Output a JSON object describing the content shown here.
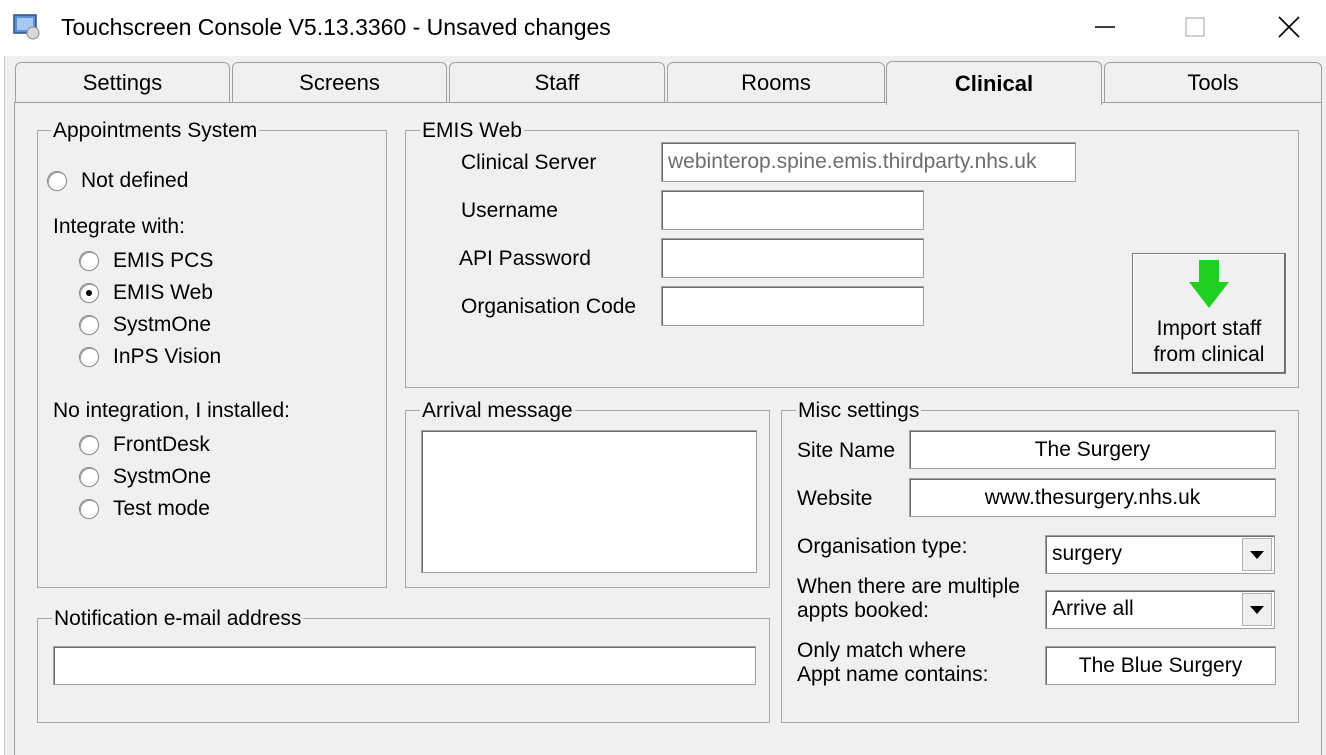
{
  "window": {
    "title": "Touchscreen Console V5.13.3360 - Unsaved changes",
    "icon": "console-app-icon",
    "controls": [
      "minimize",
      "maximize",
      "close"
    ]
  },
  "tabs": [
    {
      "label": "Settings",
      "active": false
    },
    {
      "label": "Screens",
      "active": false
    },
    {
      "label": "Staff",
      "active": false
    },
    {
      "label": "Rooms",
      "active": false
    },
    {
      "label": "Clinical",
      "active": true
    },
    {
      "label": "Tools",
      "active": false
    }
  ],
  "appointments": {
    "title": "Appointments System",
    "not_defined": "Not defined",
    "integrate_label": "Integrate with:",
    "integrate_options": [
      {
        "label": "EMIS PCS",
        "checked": false
      },
      {
        "label": "EMIS Web",
        "checked": true
      },
      {
        "label": "SystmOne",
        "checked": false
      },
      {
        "label": "InPS Vision",
        "checked": false
      }
    ],
    "no_integration_label": "No integration, I installed:",
    "no_integration_options": [
      {
        "label": "FrontDesk",
        "checked": false
      },
      {
        "label": "SystmOne",
        "checked": false
      },
      {
        "label": "Test mode",
        "checked": false
      }
    ]
  },
  "emis_web": {
    "title": "EMIS Web",
    "clinical_server_label": "Clinical Server",
    "clinical_server_value": "webinterop.spine.emis.thirdparty.nhs.uk",
    "username_label": "Username",
    "username_value": "",
    "api_password_label": "API Password",
    "api_password_value": "",
    "org_code_label": "Organisation Code",
    "org_code_value": "",
    "import_button": [
      "Import staff",
      "from clinical"
    ]
  },
  "arrival": {
    "title": "Arrival message",
    "value": ""
  },
  "misc": {
    "title": "Misc settings",
    "site_name_label": "Site Name",
    "site_name_value": "The Surgery",
    "website_label": "Website",
    "website_value": "www.thesurgery.nhs.uk",
    "org_type_label": "Organisation type:",
    "org_type_value": "surgery",
    "multiple_appts_label": [
      "When there are multiple",
      "appts booked:"
    ],
    "multiple_appts_value": "Arrive all",
    "match_label": [
      "Only match where",
      "Appt name contains:"
    ],
    "match_value": "The Blue Surgery"
  },
  "notification": {
    "title": "Notification e-mail address",
    "value": ""
  },
  "colors": {
    "arrow_green": "#1fd020",
    "panel_bg": "#f0f0f0"
  }
}
